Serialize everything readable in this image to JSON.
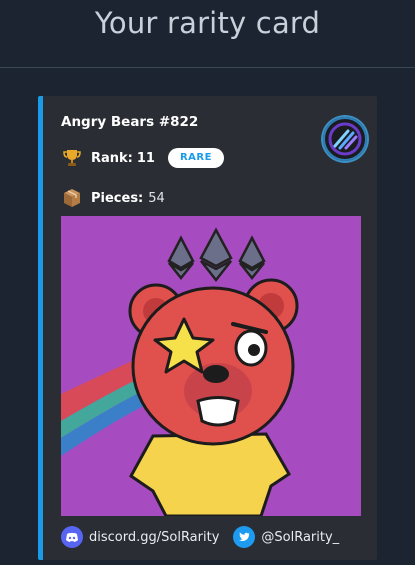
{
  "page": {
    "title": "Your rarity card"
  },
  "card": {
    "name": "Angry Bears #822",
    "rank_label": "Rank:",
    "rank_value": "11",
    "rarity": "RARE",
    "pieces_label": "Pieces:",
    "pieces_value": "54",
    "accent_color": "#1a9be8",
    "nft_background": "#a64bc0"
  },
  "footer": {
    "discord": "discord.gg/SolRarity",
    "twitter": "@SolRarity_"
  },
  "icons": {
    "rank": "trophy-icon",
    "pieces": "box-icon",
    "discord": "discord-icon",
    "twitter": "twitter-icon",
    "brand": "solrarity-logo"
  }
}
